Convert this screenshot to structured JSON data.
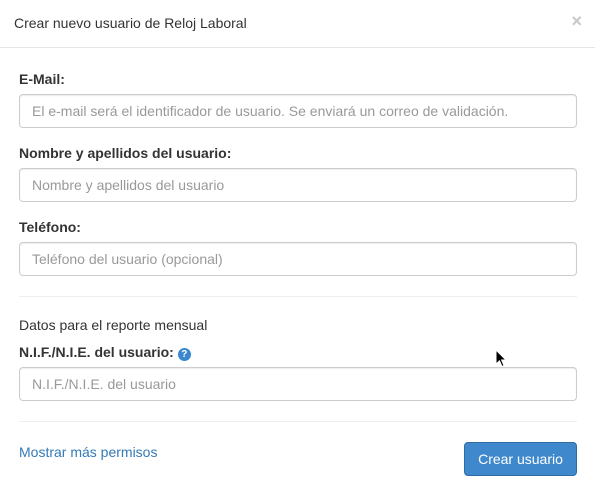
{
  "modal": {
    "title": "Crear nuevo usuario de Reloj Laboral",
    "close_glyph": "×"
  },
  "form": {
    "email": {
      "label": "E-Mail:",
      "placeholder": "El e-mail será el identificador de usuario. Se enviará un correo de validación.",
      "value": ""
    },
    "name": {
      "label": "Nombre y apellidos del usuario:",
      "placeholder": "Nombre y apellidos del usuario",
      "value": ""
    },
    "phone": {
      "label": "Teléfono:",
      "placeholder": "Teléfono del usuario (opcional)",
      "value": ""
    },
    "section_title": "Datos para el reporte mensual",
    "nif": {
      "label": "N.I.F./N.I.E. del usuario:",
      "placeholder": "N.I.F./N.I.E. del usuario",
      "help_glyph": "?",
      "value": ""
    }
  },
  "footer": {
    "more_permissions_link": "Mostrar más permisos",
    "create_button": "Crear usuario"
  },
  "icons": {
    "close": "close-icon",
    "help": "question-circle-icon",
    "cursor": "mouse-pointer-icon"
  },
  "colors": {
    "link": "#337ab7",
    "primary_button": "#3f88cc",
    "help_icon": "#3a87cf",
    "placeholder": "#999999"
  }
}
